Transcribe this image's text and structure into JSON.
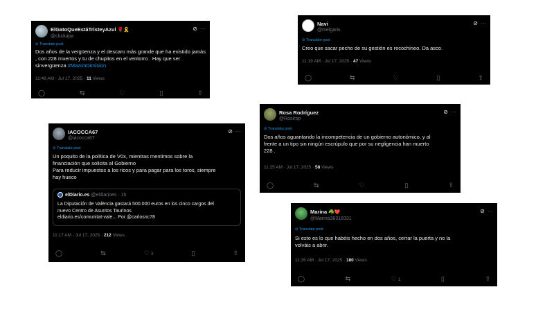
{
  "tweets": [
    {
      "display_name": "ElGatoQueEstáTristeyAzul",
      "emoji": "🌹🎗️",
      "handle": "@cluduipa",
      "translate": "Translate post",
      "text_lines": [
        "Dos años de la vergüenza y el descaro más grande que ha existido jamás",
        ", con 228 muertos y tu de chupitos en el ventorro . Hay que ser",
        "sinvergüenza "
      ],
      "hashtag": "#MazonDimision",
      "time": "11:48 AM · Jul 17, 2025 · ",
      "views": "11",
      "views_label": " Views"
    },
    {
      "display_name": "Navi",
      "handle": "@melgaris",
      "translate": "Translate post",
      "text_lines": [
        "Creo que sacar pecho de su gestión es recochineo. Da asco."
      ],
      "time": "11:19 AM · Jul 17, 2025 · ",
      "views": "47",
      "views_label": " Views"
    },
    {
      "display_name": "Rosa Rodríguez",
      "handle": "@Rosirop",
      "translate": "Translate post",
      "text_lines": [
        "Dos años aguantando la incompetencia de un gobierno autonómico, y al",
        "frente a un tipo sin ningún escrúpulo que por su negligencia han muerto",
        "228 ."
      ],
      "time": "11:25 AM · Jul 17, 2025 · ",
      "views": "58",
      "views_label": " Views"
    },
    {
      "display_name": "IACOCCA67",
      "handle": "@iacocca67",
      "translate": "Translate post",
      "text_lines": [
        "Un poquito de la política de V0x, mientras mentimos sobre la",
        "financiación que solicita al Gobierno",
        "Para reducir impuestos a los ricos y para pagar para los toros, siempre",
        "hay hueco"
      ],
      "quote": {
        "name": "elDiario.es",
        "handle": "@eldiarioes · 1h",
        "lines": [
          "La Diputación de València gastará 500.000 euros en los cinco cargos del",
          "nuevo Centro de Asuntos Taurinos",
          "eldiario.es/comunitat-vale... Por @carlosnc78"
        ]
      },
      "time": "11:17 AM · Jul 17, 2025 · ",
      "views": "212",
      "views_label": " Views",
      "likes": "3"
    },
    {
      "display_name": "Marina",
      "emoji": "☘️❤️",
      "handle": "@Marina38318331",
      "translate": "Translate post",
      "text_lines": [
        "Si esto es lo que habéis hecho en dos años, cerrar la puerta y no la",
        "volváis a abrir."
      ],
      "time": "11:26 AM · Jul 17, 2025 · ",
      "views": "180",
      "views_label": " Views",
      "likes": "1"
    }
  ],
  "icons": {
    "grok": "⊘",
    "more": "···",
    "reply": "◯",
    "retweet": "⇆",
    "like": "♡",
    "bookmark": "▯",
    "share": "⇧",
    "translate": "⊘"
  },
  "colors": {
    "card_bg": "#000000",
    "link": "#1d9bf0",
    "muted": "#71767b",
    "text": "#e7e9ea"
  }
}
